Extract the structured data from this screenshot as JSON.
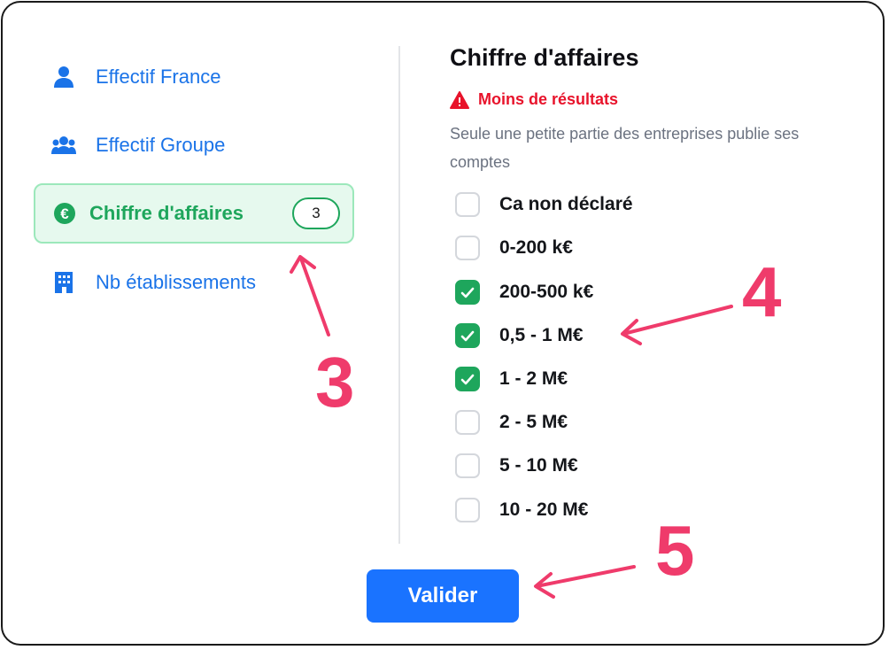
{
  "sidebar": {
    "items": [
      {
        "label": "Effectif France",
        "icon": "user-icon"
      },
      {
        "label": "Effectif Groupe",
        "icon": "users-icon"
      },
      {
        "label": "Chiffre d'affaires",
        "icon": "euro-icon",
        "badge": "3",
        "active": true
      },
      {
        "label": "Nb établissements",
        "icon": "building-icon"
      }
    ]
  },
  "panel": {
    "title": "Chiffre d'affaires",
    "warning": "Moins de résultats",
    "description": "Seule une petite partie des entreprises publie ses comptes",
    "options": [
      {
        "label": "Ca non déclaré",
        "checked": false
      },
      {
        "label": "0-200 k€",
        "checked": false
      },
      {
        "label": "200-500 k€",
        "checked": true
      },
      {
        "label": "0,5 - 1 M€",
        "checked": true
      },
      {
        "label": "1 - 2 M€",
        "checked": true
      },
      {
        "label": "2 - 5 M€",
        "checked": false
      },
      {
        "label": "5 - 10 M€",
        "checked": false
      },
      {
        "label": "10 - 20 M€",
        "checked": false
      }
    ]
  },
  "submit_label": "Valider",
  "annotations": [
    "3",
    "4",
    "5"
  ],
  "colors": {
    "accent_blue": "#1a73e8",
    "active_green": "#1ea65c",
    "warning_red": "#e8132b",
    "annotation_pink": "#ef3b6b",
    "button_blue": "#1a73ff"
  }
}
